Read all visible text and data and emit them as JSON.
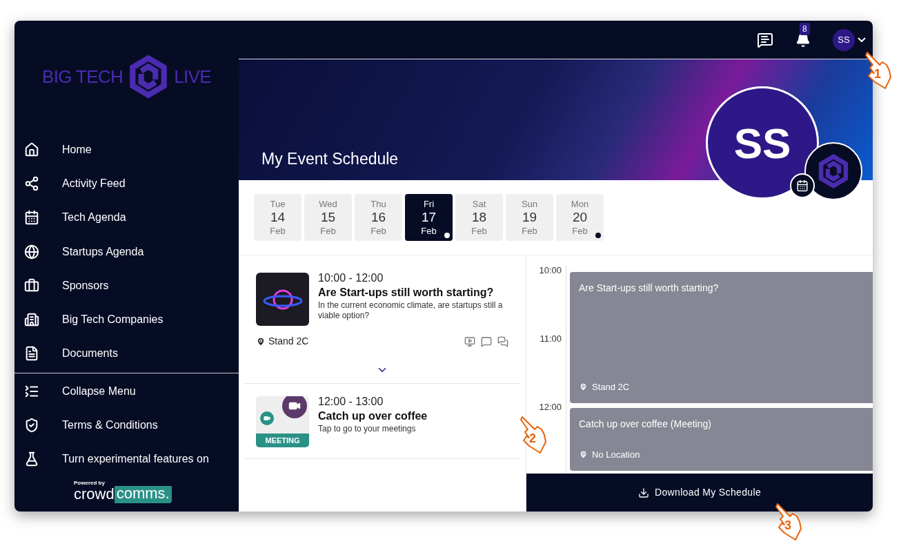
{
  "sidebar": {
    "logo": {
      "left": "BIG TECH",
      "right": "LIVE"
    },
    "nav_items": [
      {
        "label": "Home"
      },
      {
        "label": "Activity Feed"
      },
      {
        "label": "Tech Agenda"
      },
      {
        "label": "Startups Agenda"
      },
      {
        "label": "Sponsors"
      },
      {
        "label": "Big Tech Companies"
      },
      {
        "label": "Documents"
      }
    ],
    "footer_items": [
      {
        "label": "Collapse Menu"
      },
      {
        "label": "Terms & Conditions"
      },
      {
        "label": "Turn experimental features on"
      }
    ],
    "powered_by": {
      "caption": "Powered by",
      "brand_left": "crowd",
      "brand_right": "comms."
    }
  },
  "topbar": {
    "notification_count": "8",
    "avatar_initials": "SS"
  },
  "banner": {
    "title": "My Event Schedule",
    "avatar_initials": "SS"
  },
  "dates": [
    {
      "weekday": "Tue",
      "day": "14",
      "month": "Feb",
      "selected": false,
      "has_events": false
    },
    {
      "weekday": "Wed",
      "day": "15",
      "month": "Feb",
      "selected": false,
      "has_events": false
    },
    {
      "weekday": "Thu",
      "day": "16",
      "month": "Feb",
      "selected": false,
      "has_events": false
    },
    {
      "weekday": "Fri",
      "day": "17",
      "month": "Feb",
      "selected": true,
      "has_events": true
    },
    {
      "weekday": "Sat",
      "day": "18",
      "month": "Feb",
      "selected": false,
      "has_events": false
    },
    {
      "weekday": "Sun",
      "day": "19",
      "month": "Feb",
      "selected": false,
      "has_events": false
    },
    {
      "weekday": "Mon",
      "day": "20",
      "month": "Feb",
      "selected": false,
      "has_events": true
    }
  ],
  "sessions": [
    {
      "kind": "session",
      "time": "10:00 - 12:00",
      "title": "Are Start-ups still worth starting?",
      "description": "In the current economic climate, are startups still a viable option?",
      "location": "Stand 2C",
      "expanded": false
    },
    {
      "kind": "meeting",
      "time": "12:00 - 13:00",
      "title": "Catch up over coffee",
      "description": "Tap to go to your meetings",
      "thumbnail_label": "MEETING"
    }
  ],
  "calendar": {
    "hours": [
      "10:00",
      "11:00",
      "12:00"
    ],
    "events": [
      {
        "title": "Are Start-ups still worth starting?",
        "location": "Stand 2C"
      },
      {
        "title": "Catch up over coffee (Meeting)",
        "location": "No Location"
      }
    ]
  },
  "download_button": "Download My Schedule",
  "annotations": [
    {
      "label": "1"
    },
    {
      "label": "2"
    },
    {
      "label": "3"
    }
  ]
}
